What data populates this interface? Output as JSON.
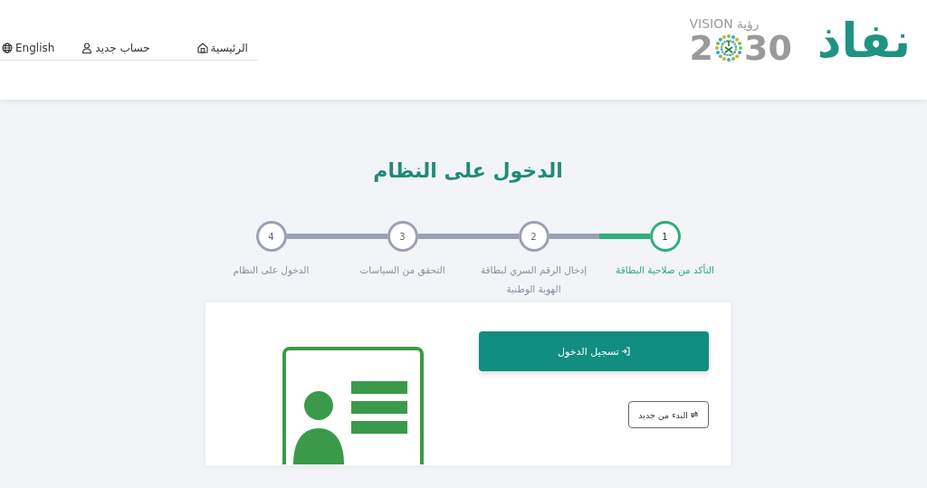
{
  "header": {
    "brand": "نفاذ",
    "vision_logo": {
      "word_en": "VISION",
      "word_ar": "رؤية",
      "year_start": "2",
      "year_end": "30"
    },
    "nav": [
      {
        "label": "الرئيسية"
      },
      {
        "label": "حساب جديد"
      },
      {
        "label": "English"
      }
    ]
  },
  "title": "الدخول على النظام",
  "stepper": {
    "steps": [
      {
        "number": "1",
        "label": "التأكد من صلاحية البطاقة",
        "selected": true,
        "level": 0.5
      },
      {
        "number": "2",
        "label": "إدخال الرقم السري لبطاقة الهوية الوطنية",
        "selected": false
      },
      {
        "number": "3",
        "label": "التحقق من السياسات",
        "selected": false
      },
      {
        "number": "4",
        "label": "الدخول على النظام",
        "selected": false
      }
    ]
  },
  "card": {
    "login_button": "تسجيل الدخول",
    "restart_button": "البدء من جديد"
  }
}
